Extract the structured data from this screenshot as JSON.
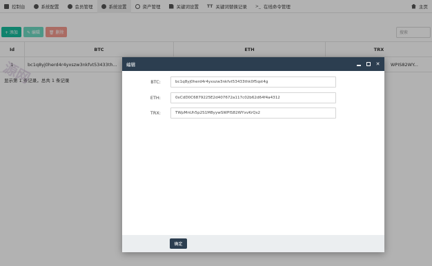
{
  "nav": {
    "items": [
      {
        "label": "控制台",
        "icon": "dashboard-icon"
      },
      {
        "label": "系统配置",
        "icon": "gear-icon"
      },
      {
        "label": "会员管理",
        "icon": "user-icon"
      },
      {
        "label": "系统设置",
        "icon": "gear-icon"
      },
      {
        "label": "资产管理",
        "icon": "circle-icon"
      },
      {
        "label": "关键词设置",
        "icon": "document-icon"
      },
      {
        "label": "关键词替换记录",
        "icon": "text-icon"
      },
      {
        "label": "在线命令管理",
        "icon": "terminal-icon"
      }
    ],
    "active_index": 3,
    "home_label": "主页"
  },
  "toolbar": {
    "add_label": "+ 添加",
    "edit_label": "✎ 编辑",
    "delete_label": "🗑 删除",
    "search_placeholder": "搜索"
  },
  "table": {
    "columns": [
      "Id",
      "BTC",
      "ETH",
      "TRX"
    ],
    "rows": [
      {
        "id": "1",
        "btc": "bc1q8yj0herd4r4yxszw3nkfvt53433th...",
        "eth": "",
        "trx": "WPIS82WY..."
      }
    ],
    "pagination_info": "显示第 1 条记录，总共 1 条记录"
  },
  "watermark": {
    "text": "源网"
  },
  "modal": {
    "title": "编辑",
    "fields": [
      {
        "label": "BTC:",
        "value": "bc1q8yj0herd4r4yxszw3nkfvt53433thk0f5qst4g"
      },
      {
        "label": "ETH:",
        "value": "0xCdD0C6879225E2d407672a117c02b62d64f4a4312"
      },
      {
        "label": "TRX:",
        "value": "TWpMnUh5p2S1M8yywSWPIS82WYxvKrQs2"
      }
    ],
    "confirm_label": "确定"
  },
  "colors": {
    "header_bg": "#2c3e50",
    "add_btn": "#18bc9c",
    "edit_btn": "#6ed9c2",
    "delete_btn": "#f49a8f"
  }
}
